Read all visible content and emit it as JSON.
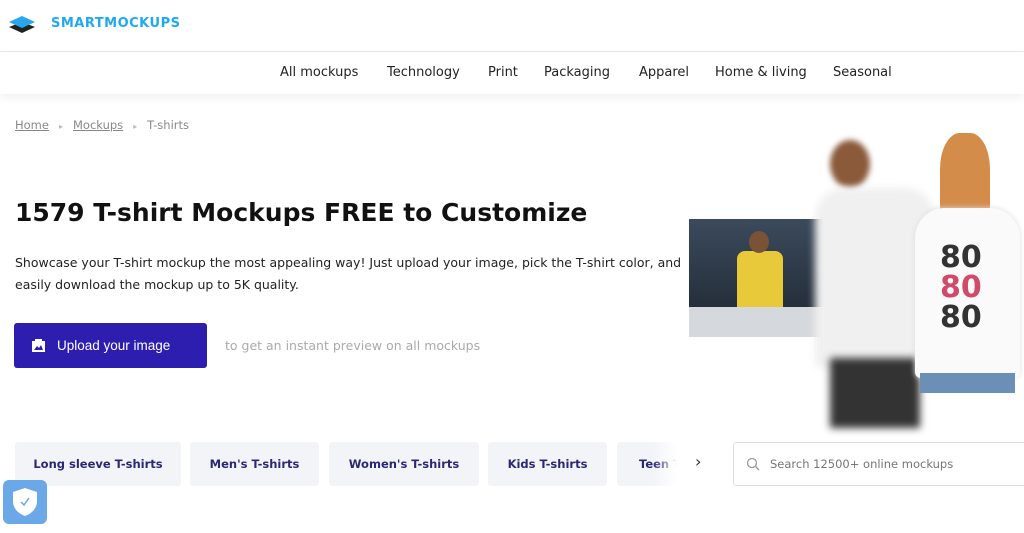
{
  "header": {
    "brand": "SMARTMOCKUPS",
    "brand_color": "#1eaaf1"
  },
  "nav": [
    "All mockups",
    "Technology",
    "Print",
    "Packaging",
    "Apparel",
    "Home & living",
    "Seasonal"
  ],
  "breadcrumb": [
    "Home",
    "Mockups",
    "T-shirts"
  ],
  "hero": {
    "title": "1579 T-shirt Mockups FREE to Customize",
    "description": "Showcase your T-shirt mockup the most appealing way! Just upload your image, pick the T-shirt color, and easily download the mockup up to 5K quality.",
    "upload_label": "Upload your image",
    "hint": "to get an instant preview on all mockups",
    "accent": "#2e1eb0"
  },
  "categories": [
    "Long sleeve T-shirts",
    "Men's T-shirts",
    "Women's T-shirts",
    "Kids T-shirts",
    "Teen T-shirts"
  ],
  "search": {
    "placeholder": "Search 12500+ online mockups"
  }
}
